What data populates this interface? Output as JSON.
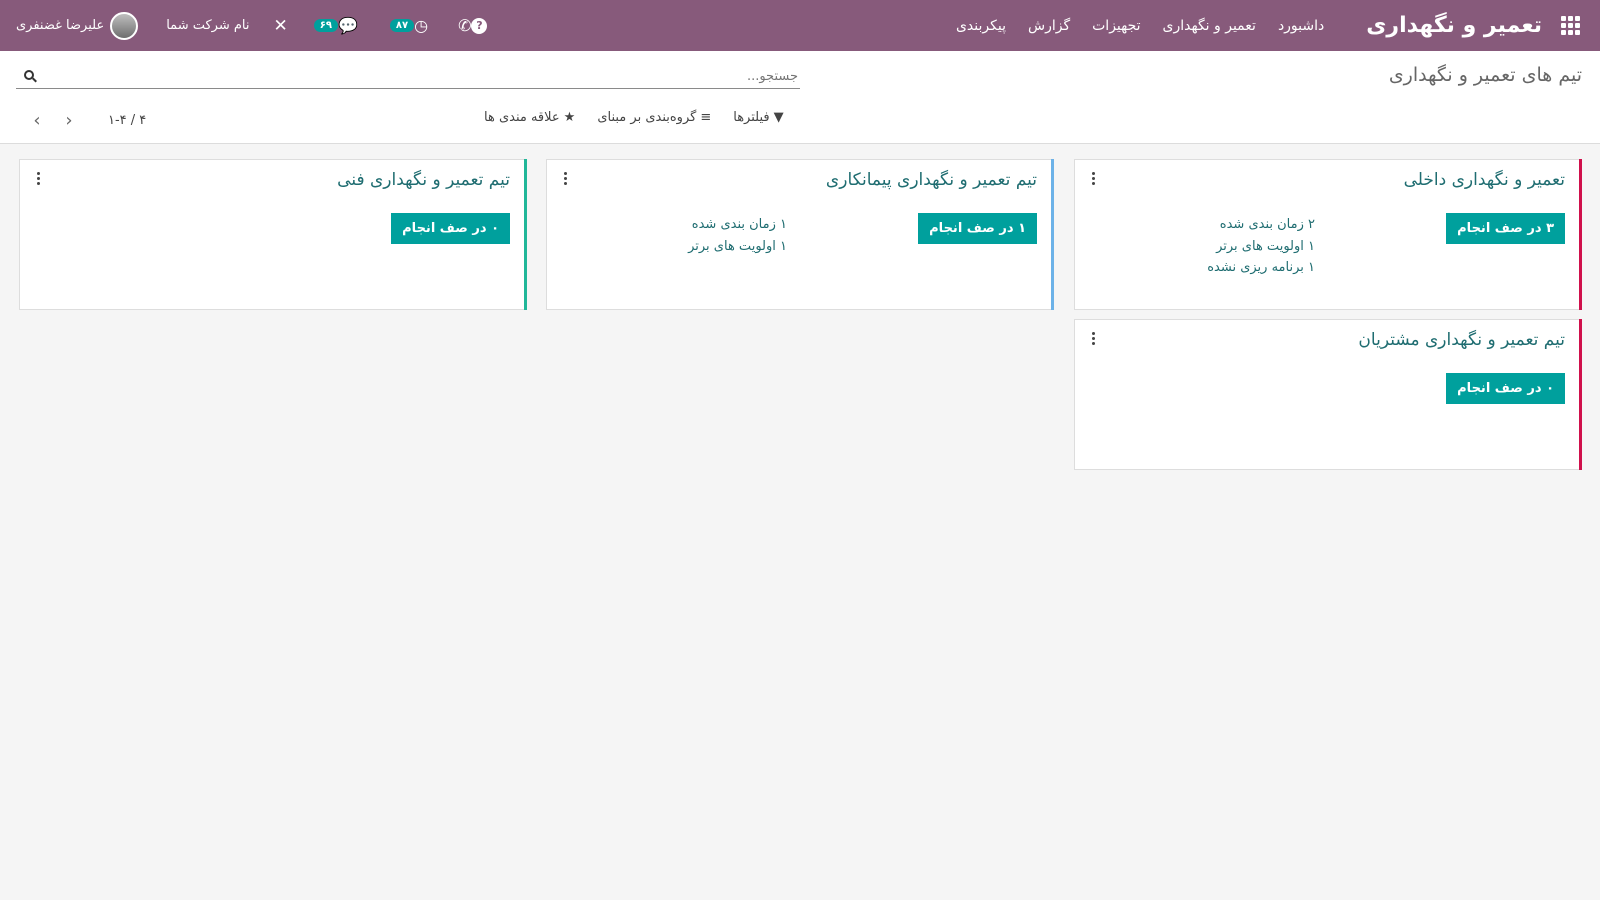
{
  "navbar": {
    "app_name": "تعمیر و نگهداری",
    "menu": [
      "داشبورد",
      "تعمیر و نگهداری",
      "تجهیزات",
      "گزارش",
      "پیکربندی"
    ],
    "chat_count": "۶۹",
    "activity_count": "۸۷",
    "company": "نام شرکت شما",
    "user": "علیرضا غضنفری",
    "accent_color": "#875a7b"
  },
  "control_panel": {
    "breadcrumb": "تیم های تعمیر و نگهداری",
    "search_placeholder": "جستجو...",
    "filters_label": "فیلترها",
    "groupby_label": "گروه‌بندی بر مبنای",
    "favorites_label": "علاقه مندی ها",
    "pager_value": "۱-۴ / ۴"
  },
  "teams": [
    {
      "name": "تعمیر و نگهداری داخلی",
      "todo_label": "۳ در صف انجام",
      "color": "#d0104c",
      "stats": [
        "۲ زمان بندی شده",
        "۱ اولویت های برتر",
        "۱ برنامه ریزی نشده"
      ]
    },
    {
      "name": "تیم تعمیر و نگهداری پیمانکاری",
      "todo_label": "۱ در صف انجام",
      "color": "#6cb2e8",
      "stats": [
        "۱ زمان بندی شده",
        "۱ اولویت های برتر"
      ]
    },
    {
      "name": "تیم تعمیر و نگهداری فنی",
      "todo_label": "۰ در صف انجام",
      "color": "#21b799",
      "stats": []
    },
    {
      "name": "تیم تعمیر و نگهداری مشتریان",
      "todo_label": "۰ در صف انجام",
      "color": "#d0104c",
      "stats": []
    }
  ]
}
